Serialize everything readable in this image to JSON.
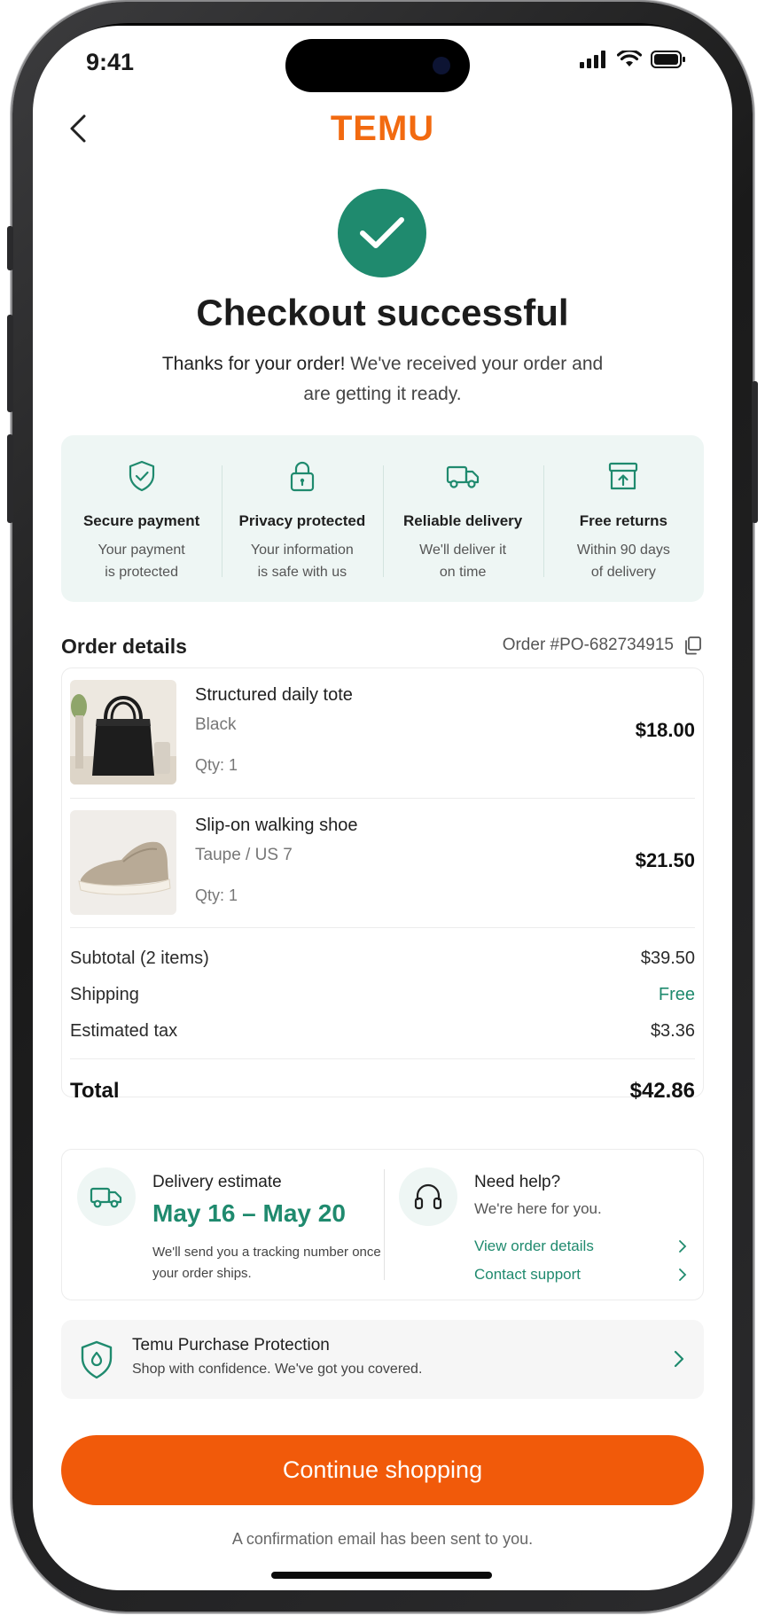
{
  "status_bar": {
    "time": "9:41"
  },
  "header": {
    "logo": "TEMU"
  },
  "success": {
    "title": "Checkout successful",
    "subtitle_strong": "Thanks for your order!",
    "subtitle_rest": " We've received your order and are getting it ready."
  },
  "trust_badges": [
    {
      "icon": "shield-check-icon",
      "title": "Secure payment",
      "line1": "Your payment",
      "line2": "is protected"
    },
    {
      "icon": "lock-icon",
      "title": "Privacy protected",
      "line1": "Your information",
      "line2": "is safe with us"
    },
    {
      "icon": "truck-icon",
      "title": "Reliable delivery",
      "line1": "We'll deliver it",
      "line2": "on time"
    },
    {
      "icon": "return-box-icon",
      "title": "Free returns",
      "line1": "Within 90 days",
      "line2": "of delivery"
    }
  ],
  "order": {
    "heading": "Order details",
    "number": "Order #PO-682734915",
    "items": [
      {
        "name": "Structured daily tote",
        "variant": "Black",
        "qty": "Qty: 1",
        "price": "$18.00"
      },
      {
        "name": "Slip-on walking shoe",
        "variant": "Taupe / US 7",
        "qty": "Qty: 1",
        "price": "$21.50"
      }
    ],
    "summary": [
      {
        "label": "Subtotal (2 items)",
        "value": "$39.50"
      },
      {
        "label": "Shipping",
        "value": "Free"
      },
      {
        "label": "Estimated tax",
        "value": "$3.36"
      }
    ],
    "total_label": "Total",
    "total_value": "$42.86"
  },
  "delivery": {
    "title": "Delivery estimate",
    "date": "May 16 – May 20",
    "note": "We'll send you a tracking number once your order ships."
  },
  "help": {
    "title": "Need help?",
    "subtitle": "We're here for you.",
    "links": [
      "View order details",
      "Contact support"
    ]
  },
  "protection": {
    "title": "Temu Purchase Protection",
    "subtitle": "Shop with confidence. We've got you covered."
  },
  "cta_label": "Continue shopping",
  "confirmation": "A confirmation email has been sent to you.",
  "colors": {
    "brand": "#f26a10",
    "accent": "#1f8a6e",
    "cta": "#f15a0a"
  }
}
